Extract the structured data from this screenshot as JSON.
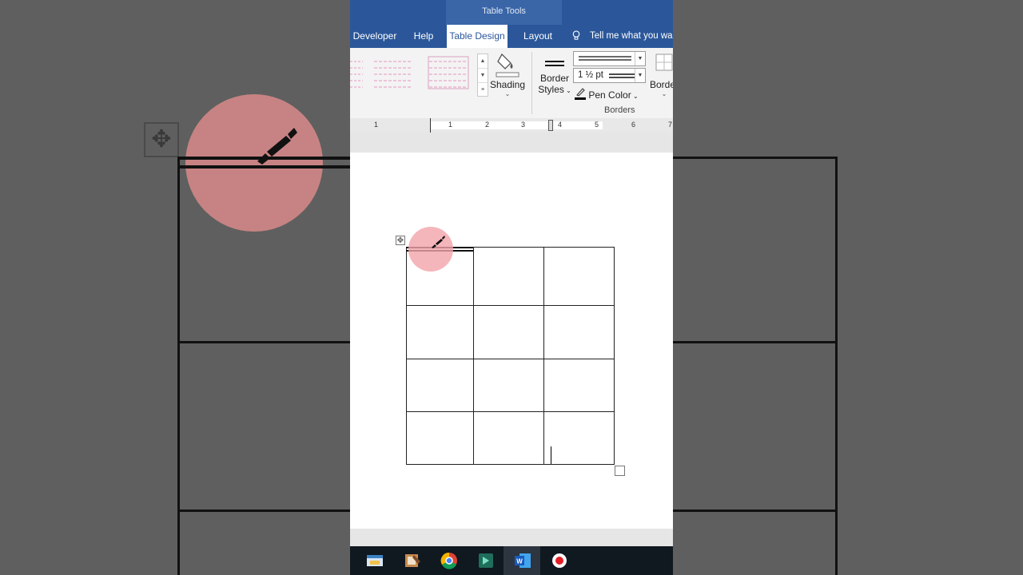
{
  "ribbon_context": {
    "label": "Table Tools"
  },
  "tabs": [
    {
      "label": "Developer",
      "active": false
    },
    {
      "label": "Help",
      "active": false
    },
    {
      "label": "Table Design",
      "active": true
    },
    {
      "label": "Layout",
      "active": false
    }
  ],
  "tell_me": {
    "placeholder": "Tell me what you wa"
  },
  "ribbon": {
    "shading_label": "Shading",
    "border_styles_label_1": "Border",
    "border_styles_label_2": "Styles",
    "pen_weight_value": "1 ½ pt",
    "pen_color_label": "Pen Color",
    "borders_label": "Border",
    "group_label": "Borders"
  },
  "ruler": {
    "numbers": [
      "1",
      "1",
      "2",
      "3",
      "4",
      "5",
      "6",
      "7"
    ]
  },
  "table": {
    "rows": 4,
    "columns": 3
  },
  "taskbar": {
    "icons": [
      "file-explorer-icon",
      "paint-icon",
      "chrome-icon",
      "filmora-icon",
      "word-icon",
      "screen-recorder-icon"
    ]
  },
  "colors": {
    "ribbon_blue": "#2b579a",
    "highlight_pink": "#f2a4aa"
  }
}
